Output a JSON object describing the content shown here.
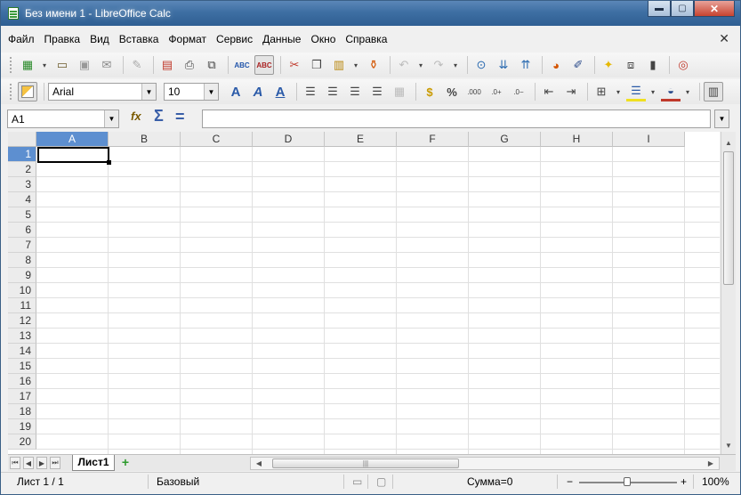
{
  "window": {
    "title": "Без имени 1 - LibreOffice Calc",
    "minimize": "▬",
    "maximize": "▢",
    "close": "✕"
  },
  "menu": {
    "items": [
      "Файл",
      "Правка",
      "Вид",
      "Вставка",
      "Формат",
      "Сервис",
      "Данные",
      "Окно",
      "Справка"
    ],
    "close_doc": "✕"
  },
  "toolbar_standard": {
    "icons": [
      "new-document-icon",
      "open-icon",
      "save-icon",
      "email-icon",
      "edit-file-icon",
      "export-pdf-icon",
      "print-icon",
      "print-preview-icon",
      "spellcheck-icon",
      "autospellcheck-icon",
      "cut-icon",
      "copy-icon",
      "paste-icon",
      "clone-formatting-icon",
      "undo-icon",
      "redo-icon",
      "navigator-icon",
      "sort-descending-icon",
      "sort-ascending-icon",
      "chart-icon",
      "draw-functions-icon",
      "gallery-icon",
      "data-sources-icon",
      "help-icon"
    ]
  },
  "toolbar_formatting": {
    "font_name": "Arial",
    "font_size": "10",
    "percent": "%",
    "currency": "$"
  },
  "formula_bar": {
    "name_box": "A1",
    "fx": "fx",
    "sigma": "Σ",
    "equals": "=",
    "formula": ""
  },
  "grid": {
    "columns": [
      "A",
      "B",
      "C",
      "D",
      "E",
      "F",
      "G",
      "H",
      "I"
    ],
    "rows": [
      "1",
      "2",
      "3",
      "4",
      "5",
      "6",
      "7",
      "8",
      "9",
      "10",
      "11",
      "12",
      "13",
      "14",
      "15",
      "16",
      "17",
      "18",
      "19",
      "20"
    ],
    "selected_cell": "A1"
  },
  "sheets": {
    "tabs": [
      "Лист1"
    ],
    "add": "+"
  },
  "status": {
    "sheet": "Лист 1 / 1",
    "page_style": "Базовый",
    "sum": "Сумма=0",
    "zoom": "100%",
    "zoom_minus": "−",
    "zoom_plus": "+"
  },
  "colors": {
    "selection_header": "#5d8fd0",
    "title_bar": "#3e6fa3",
    "close_button": "#c7432f"
  }
}
